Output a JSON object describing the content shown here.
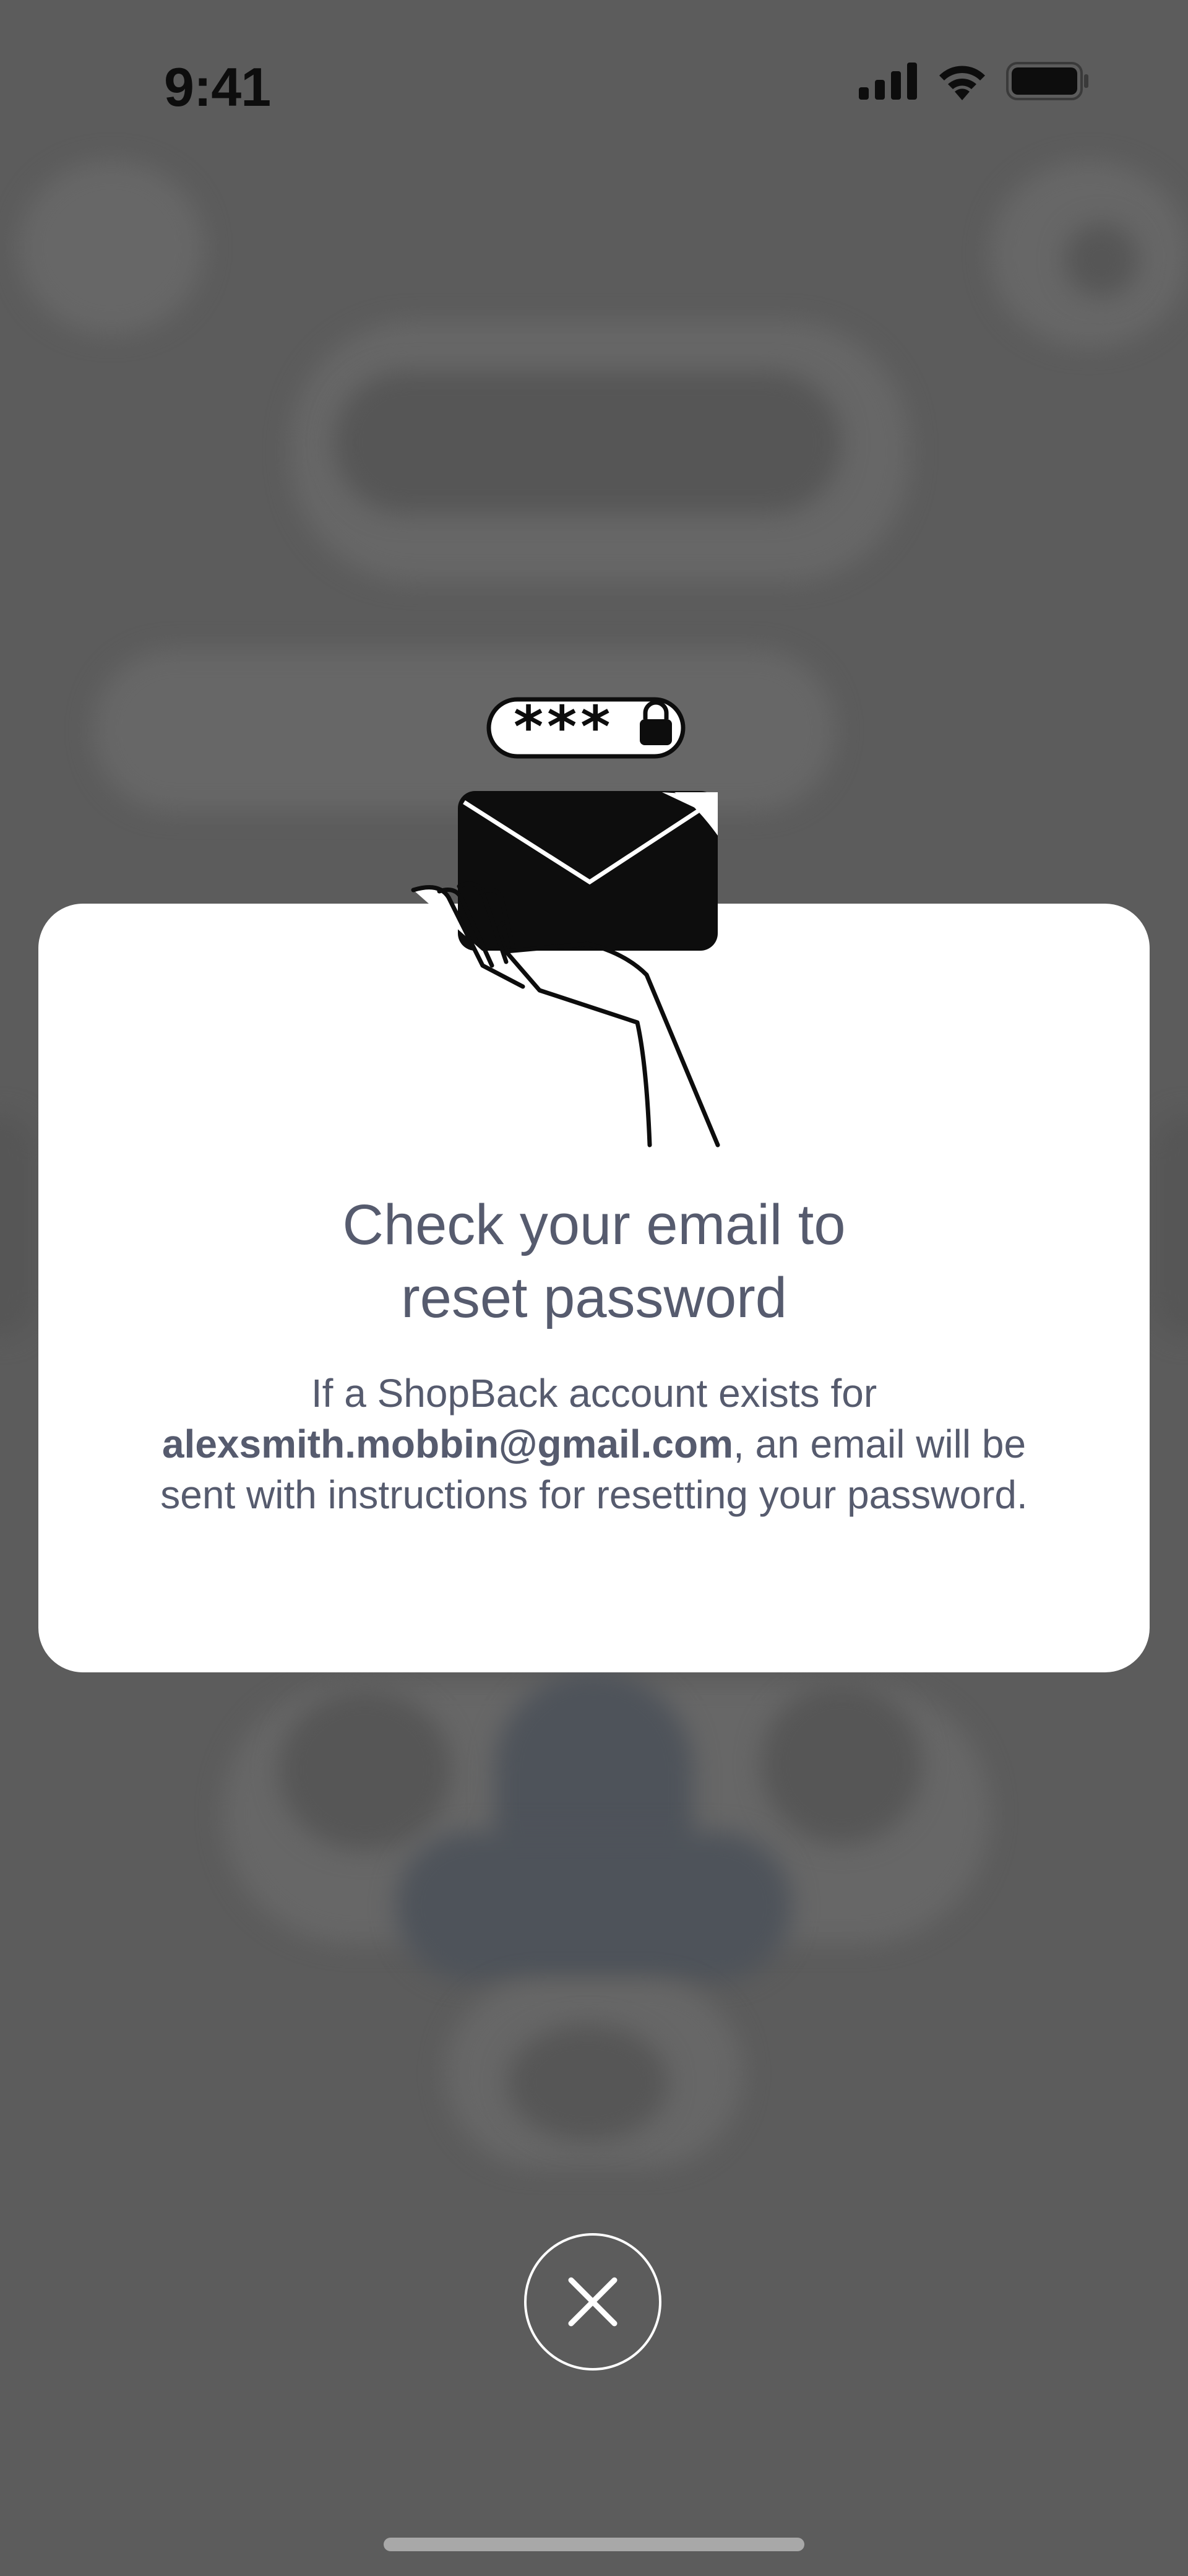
{
  "status_bar": {
    "time": "9:41"
  },
  "dialog": {
    "illustration": {
      "password_mask": "***"
    },
    "title_line1": "Check your email to",
    "title_line2": "reset password",
    "body_prefix": "If a ShopBack account exists for",
    "email": "alexsmith.mobbin@gmail.com",
    "body_suffix": ", an email will be sent with instructions for resetting your password."
  },
  "close": {
    "icon": "close-icon"
  },
  "colors": {
    "overlay": "#5c5c5c",
    "card": "#ffffff",
    "text": "#565b6e"
  }
}
